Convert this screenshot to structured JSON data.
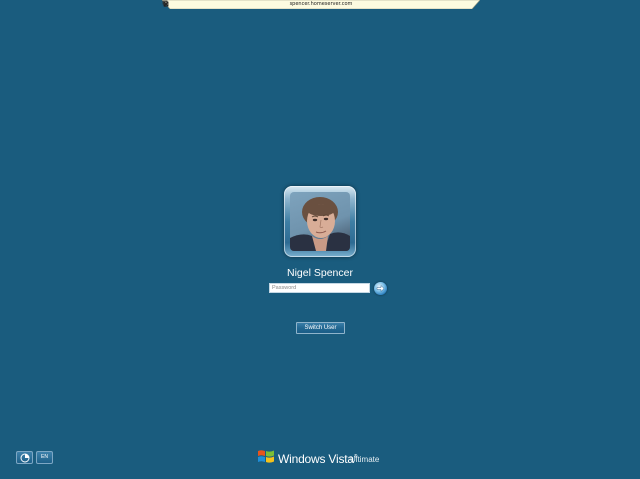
{
  "remote_bar": {
    "host": "spencer.homeserver.com",
    "icons": [
      "pin-icon",
      "minimize-icon",
      "restore-icon",
      "close-icon"
    ]
  },
  "login": {
    "user_name": "Nigel Spencer",
    "password_placeholder": "Password",
    "password_value": "",
    "submit_icon": "arrow-right-icon",
    "switch_user_label": "Switch User"
  },
  "footer": {
    "ease_of_access_icon": "ease-of-access-icon",
    "language": "EN",
    "brand": {
      "product": "Windows Vista",
      "trademark": "®",
      "edition": "Ultimate"
    }
  },
  "colors": {
    "background": "#1a5c7e",
    "bar_background": "#fdfbe0",
    "button_border": "#8fb4cb"
  }
}
